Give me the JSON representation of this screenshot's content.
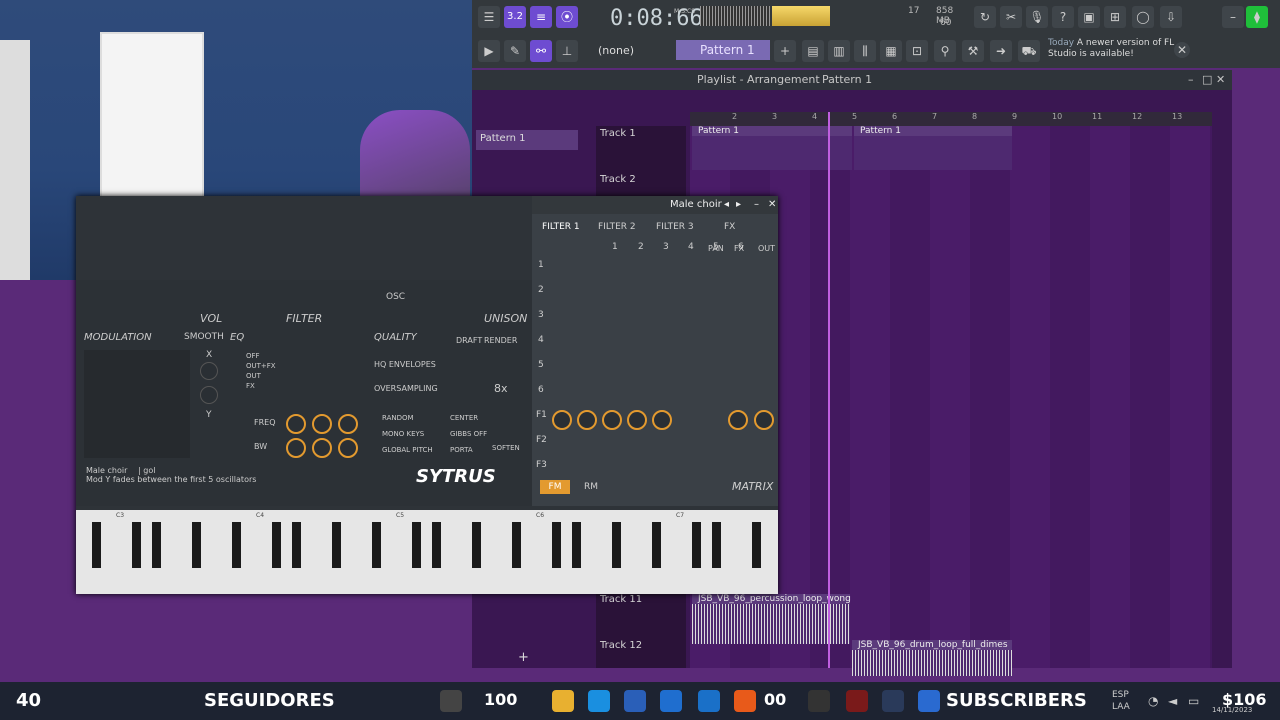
{
  "topbar": {
    "time": "0:08:66",
    "time_unit": "M:S:CS",
    "cpu_value": "17",
    "ram": "858 MB",
    "polyphony": "60",
    "none_label": "(none)",
    "pattern": "Pattern 1",
    "tempo_label": "3.2",
    "notice_today": "Today",
    "notice_text": "A newer version of FL Studio is available!"
  },
  "playlist": {
    "title": "Playlist - Arrangement",
    "breadcrumb": "Pattern 1",
    "left_pattern": "Pattern 1",
    "bar_numbers": [
      "2",
      "3",
      "4",
      "5",
      "6",
      "7",
      "8",
      "9",
      "10",
      "11",
      "12",
      "13"
    ],
    "tracks": [
      {
        "label": "Track 1"
      },
      {
        "label": "Track 2"
      },
      {
        "label": "Track 11"
      },
      {
        "label": "Track 12"
      }
    ],
    "clips": [
      {
        "name": "Pattern 1"
      },
      {
        "name": "Pattern 1"
      },
      {
        "name": "JSB_VB_96_percussion_loop_wong"
      },
      {
        "name": "JSB_VB_96_drum_loop_full_dimes"
      }
    ]
  },
  "sytrus": {
    "window_title": "Male choir",
    "tabs": [
      "FILTER 1",
      "FILTER 2",
      "FILTER 3",
      "FX"
    ],
    "col_headers": [
      "1",
      "2",
      "3",
      "4",
      "5",
      "6",
      "PAN",
      "FX",
      "OUT"
    ],
    "row_headers": [
      "1",
      "2",
      "3",
      "4",
      "5",
      "6",
      "F1",
      "F2",
      "F3"
    ],
    "osc_label": "OSC",
    "vol_label": "VOL",
    "filter_label": "FILTER",
    "unison_label": "UNISON",
    "modulation_label": "MODULATION",
    "smooth_label": "SMOOTH",
    "eq_label": "EQ",
    "quality_label": "QUALITY",
    "draft_label": "DRAFT",
    "render_label": "RENDER",
    "hq_env": "HQ ENVELOPES",
    "oversampling": "OVERSAMPLING",
    "oversampling_val": "8x",
    "routing": [
      "OFF",
      "OUT+FX",
      "OUT",
      "FX"
    ],
    "freq": "FREQ",
    "bw": "BW",
    "x_label": "X",
    "y_label": "Y",
    "random": "RANDOM",
    "center": "CENTER",
    "mono_keys": "MONO KEYS",
    "gibbs_off": "GIBBS OFF",
    "global_pitch": "GLOBAL PITCH",
    "porta": "PORTA",
    "soften": "SOFTEN",
    "preset_name": "Male choir",
    "preset_author": "| gol",
    "preset_desc": "Mod Y fades between the first 5 oscillators",
    "logo": "SYTRUS",
    "fm_tab": "FM",
    "rm_tab": "RM",
    "matrix_label": "MATRIX",
    "octaves": [
      "C3",
      "C4",
      "C5",
      "C6",
      "C7"
    ]
  },
  "taskbar": {
    "followers_count": "40",
    "followers_label": "SEGUIDORES",
    "subs_label": "SUBSCRIBERS",
    "badge_100": "100",
    "badge_00": "00",
    "lang": "ESP",
    "lang2": "LAA",
    "tray_num": "$106",
    "date": "14/11/2023"
  },
  "colors": {
    "accent": "#6e4cd1",
    "bg": "#5a2a78",
    "knob_active": "#e39a2f"
  }
}
